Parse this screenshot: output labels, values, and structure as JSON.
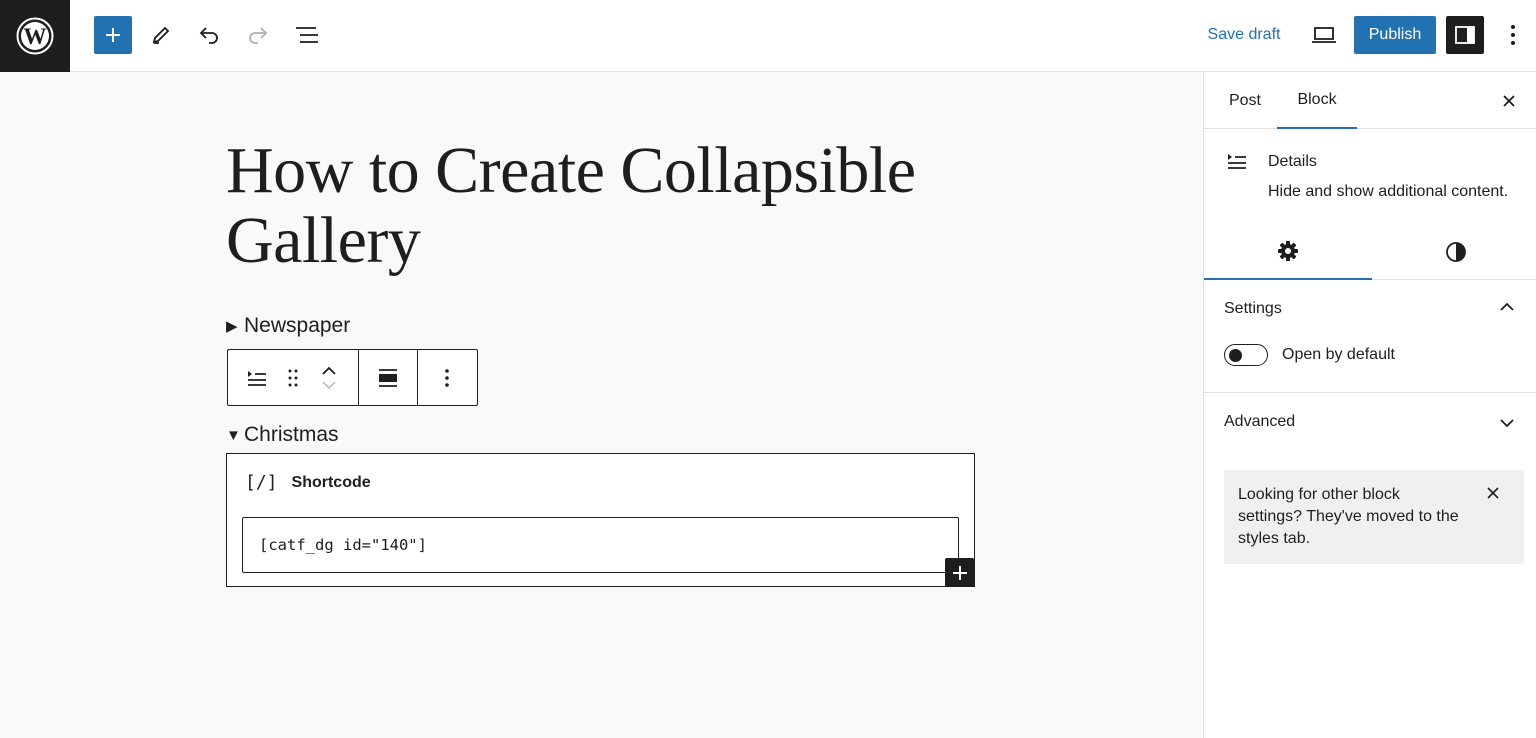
{
  "topbar": {
    "save_draft_label": "Save draft",
    "publish_label": "Publish"
  },
  "editor": {
    "post_title": "How to Create Collapsible Gallery",
    "details_blocks": [
      {
        "summary": "Newspaper",
        "open": false
      },
      {
        "summary": "Christmas",
        "open": true
      }
    ],
    "shortcode_block": {
      "label": "Shortcode",
      "icon_text": "[/]",
      "value": "[catf_dg id=\"140\"]"
    }
  },
  "sidebar": {
    "tabs": [
      {
        "label": "Post",
        "active": false
      },
      {
        "label": "Block",
        "active": true
      }
    ],
    "block_card": {
      "title": "Details",
      "description": "Hide and show additional content."
    },
    "subtabs": [
      "settings-gear-icon",
      "styles-contrast-icon"
    ],
    "settings_panel": {
      "title": "Settings",
      "toggle_label": "Open by default",
      "toggle_on": false
    },
    "advanced_panel": {
      "title": "Advanced"
    },
    "notice": {
      "text": "Looking for other block settings? They've moved to the styles tab."
    }
  },
  "colors": {
    "accent": "#2271b1",
    "dark": "#1e1e1e",
    "border": "#e0e0e0",
    "notice_bg": "#f0f0f0"
  }
}
